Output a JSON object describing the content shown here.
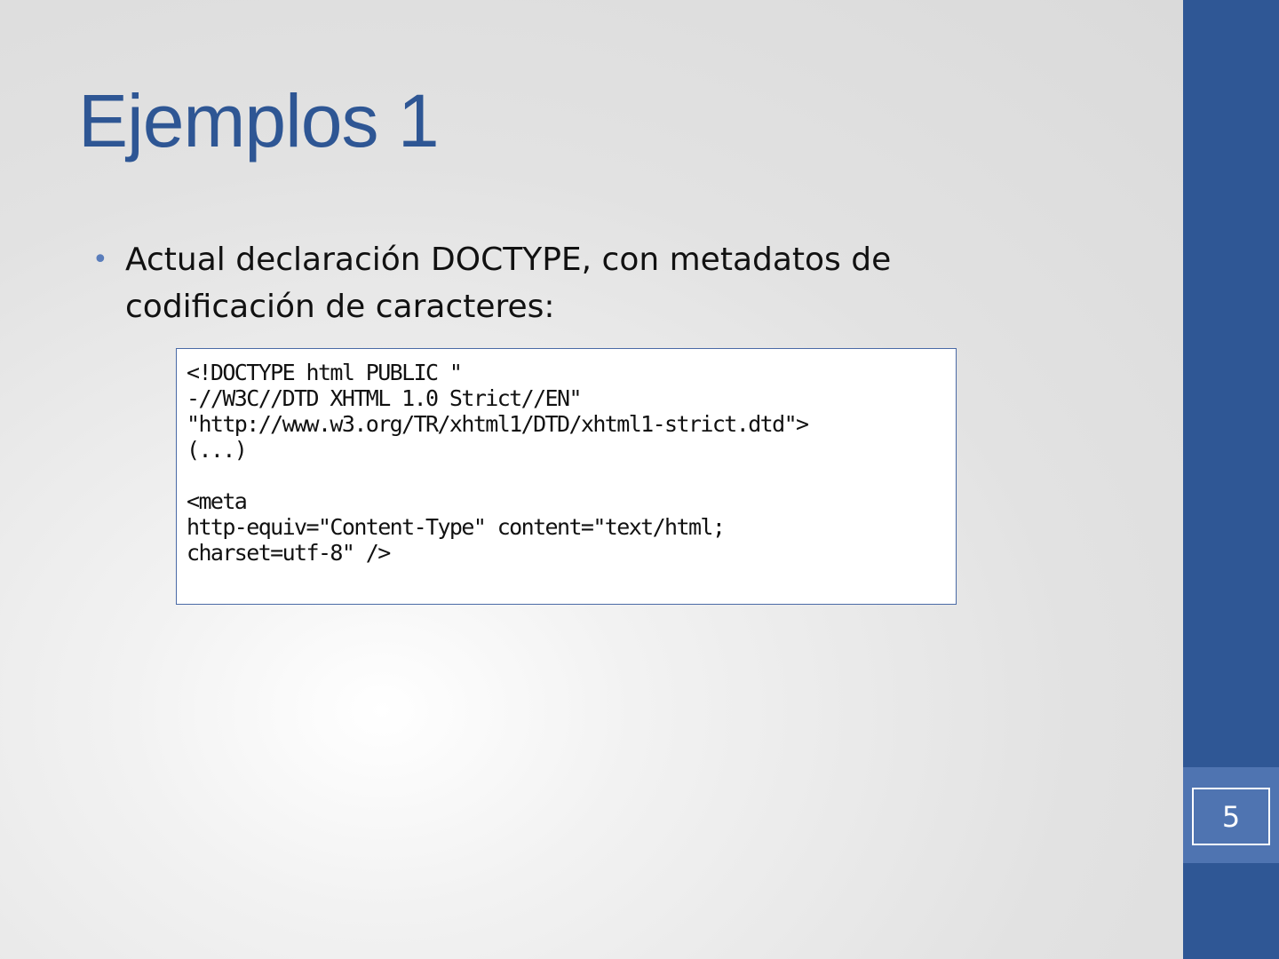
{
  "slide": {
    "title": "Ejemplos 1",
    "bullets": [
      "Actual declaración DOCTYPE, con metadatos de codificación de caracteres:"
    ],
    "code_lines": [
      "<!DOCTYPE html PUBLIC \"",
      "-//W3C//DTD XHTML 1.0 Strict//EN\"",
      "\"http://www.w3.org/TR/xhtml1/DTD/xhtml1-strict.dtd\">",
      "(...)",
      "",
      "<meta",
      "http-equiv=\"Content-Type\" content=\"text/html;",
      "charset=utf-8\" />"
    ],
    "page_number": "5"
  },
  "colors": {
    "title": "#2e5694",
    "sidebar": "#2f5795",
    "page_band": "#4f74b1",
    "bullet": "#5a7dbb"
  }
}
